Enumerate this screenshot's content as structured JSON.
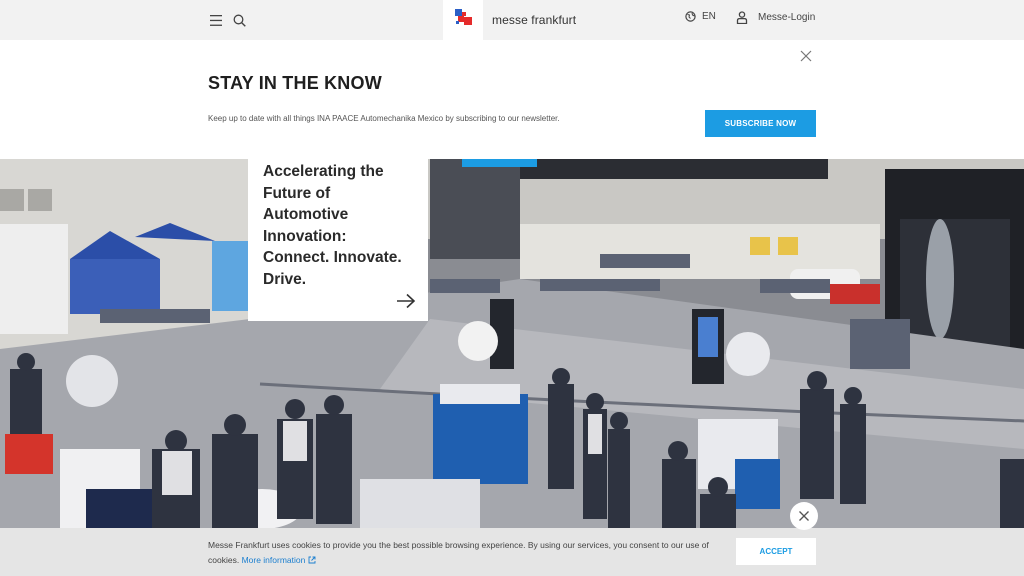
{
  "header": {
    "menu_icon": "hamburger-icon",
    "search_icon": "search-icon",
    "logo_text": "messe frankfurt",
    "language_label": "EN",
    "login_label": "Messe-Login"
  },
  "newsletter": {
    "title": "STAY IN THE KNOW",
    "text": "Keep up to date with all things INA PAACE Automechanika Mexico by subscribing to our newsletter.",
    "button_label": "SUBSCRIBE NOW"
  },
  "hero": {
    "headline": "Accelerating the\nFuture of\nAutomotive\nInnovation:\nConnect. Innovate.\nDrive."
  },
  "cookie": {
    "text": "Messe Frankfurt uses cookies to provide you the best possible browsing experience. By using our services, you consent to our use of cookies.",
    "link_label": "More information",
    "accept_label": "ACCEPT"
  },
  "colors": {
    "accent": "#1c9ce3",
    "header_bg": "#f2f2f2",
    "cookie_bg": "#e5e5e5"
  }
}
